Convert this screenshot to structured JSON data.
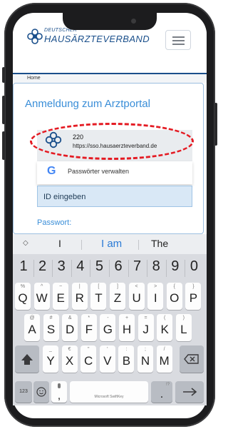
{
  "header": {
    "logo_small": "DEUTSCHER",
    "logo_big": "HAUSÄRZTEVERBAND",
    "menu_icon": "hamburger-icon"
  },
  "breadcrumb": "Home",
  "login": {
    "title": "Anmeldung zum Arztportal",
    "autofill_user": "220",
    "autofill_url": "https://sso.hausaerzteverband.de",
    "password_manager_label": "Passwörter verwalten",
    "id_placeholder": "ID eingeben",
    "password_label": "Passwort:"
  },
  "keyboard": {
    "suggestions": [
      "I",
      "I am",
      "The"
    ],
    "numbers": [
      "1",
      "2",
      "3",
      "4",
      "5",
      "6",
      "7",
      "8",
      "9",
      "0"
    ],
    "row1": [
      {
        "sym": "%",
        "key": "Q"
      },
      {
        "sym": "^",
        "key": "W"
      },
      {
        "sym": "~",
        "key": "E"
      },
      {
        "sym": "|",
        "key": "R"
      },
      {
        "sym": "[",
        "key": "T"
      },
      {
        "sym": "]",
        "key": "Z"
      },
      {
        "sym": "<",
        "key": "U"
      },
      {
        "sym": ">",
        "key": "I"
      },
      {
        "sym": "{",
        "key": "O"
      },
      {
        "sym": "}",
        "key": "P"
      }
    ],
    "row2": [
      {
        "sym": "@",
        "key": "A"
      },
      {
        "sym": "#",
        "key": "S"
      },
      {
        "sym": "&",
        "key": "D"
      },
      {
        "sym": "*",
        "key": "F"
      },
      {
        "sym": "-",
        "key": "G"
      },
      {
        "sym": "+",
        "key": "H"
      },
      {
        "sym": "=",
        "key": "J"
      },
      {
        "sym": "(",
        "key": "K"
      },
      {
        "sym": ")",
        "key": "L"
      }
    ],
    "row3": [
      {
        "sym": "_",
        "key": "Y"
      },
      {
        "sym": "€",
        "key": "X"
      },
      {
        "sym": "\"",
        "key": "C"
      },
      {
        "sym": "'",
        "key": "V"
      },
      {
        "sym": ":",
        "key": "B"
      },
      {
        "sym": ";",
        "key": "N"
      },
      {
        "sym": "/",
        "key": "M"
      }
    ],
    "key_123": "123",
    "comma": ",",
    "period": ".",
    "period_alt": "!?",
    "space_label": "Microsoft SwiftKey"
  }
}
